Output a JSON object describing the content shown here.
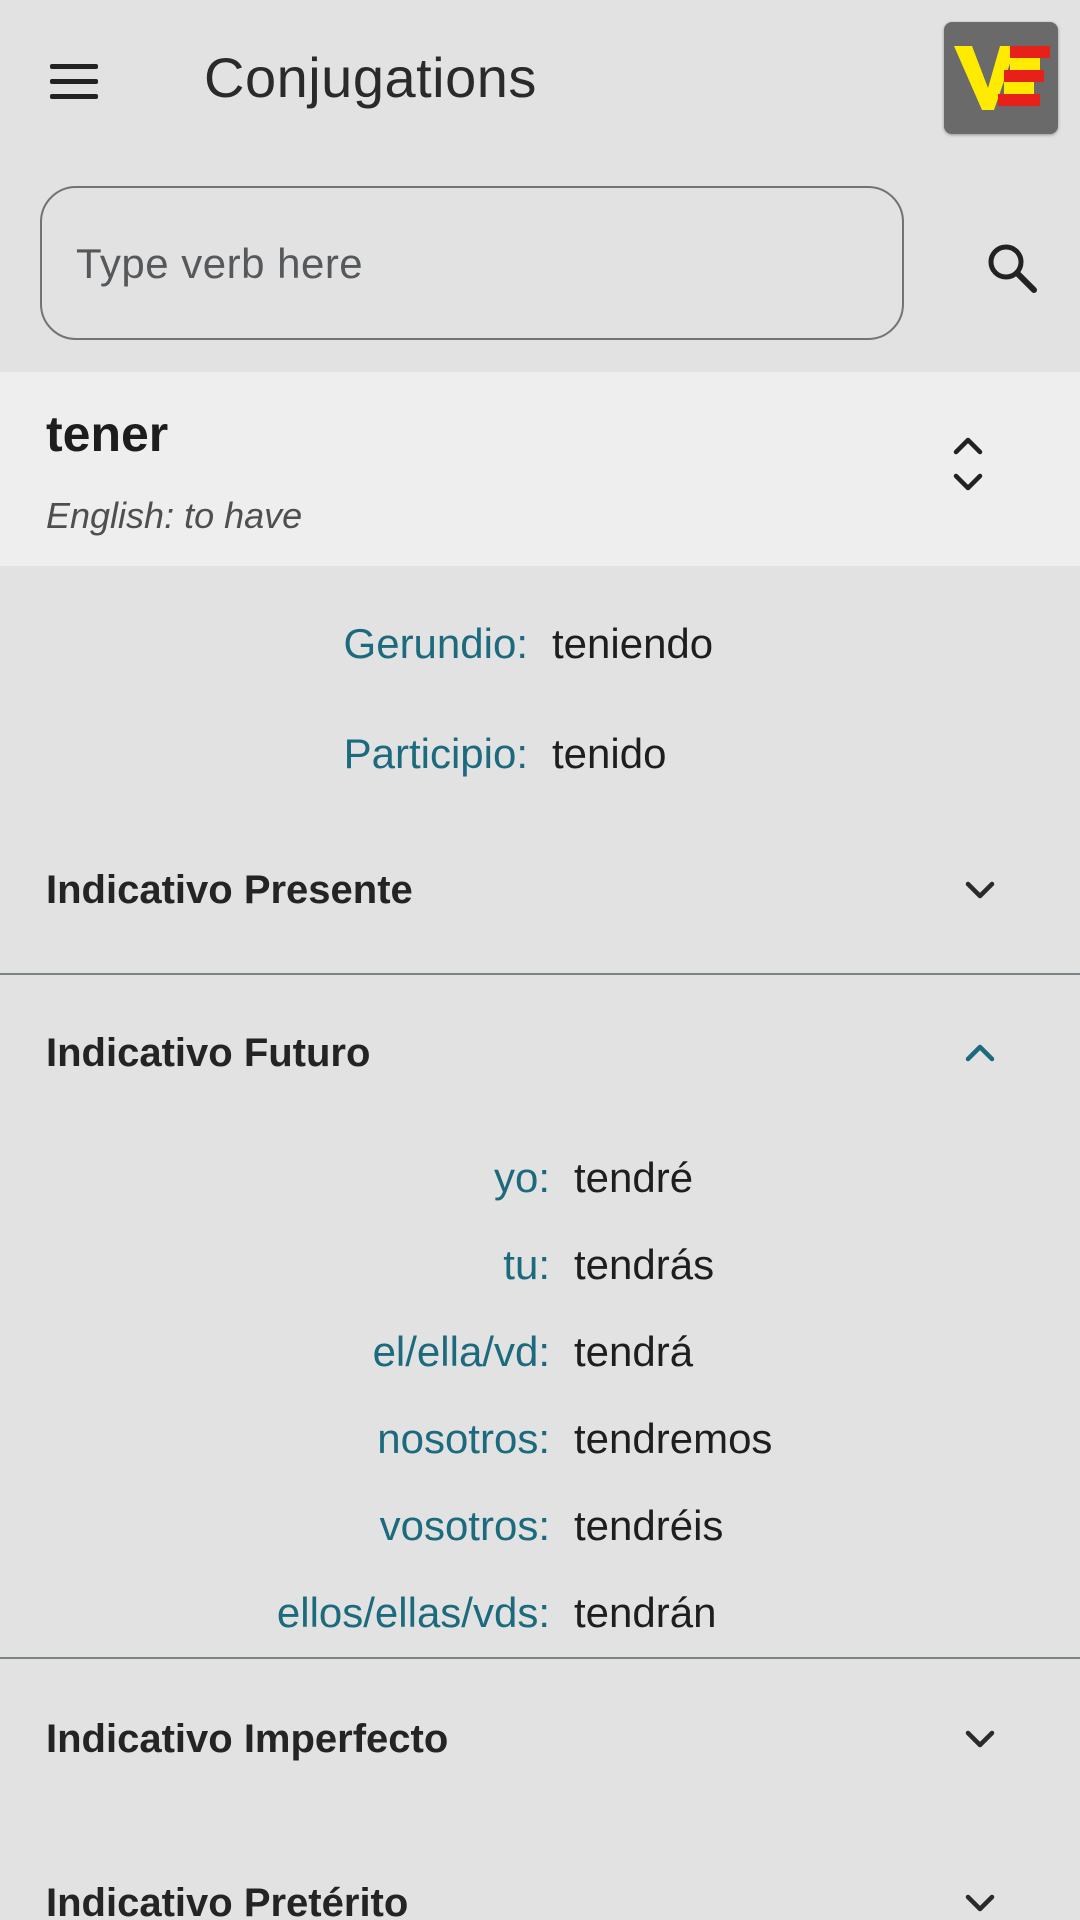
{
  "app_bar": {
    "title": "Conjugations",
    "menu_icon": "hamburger-menu-icon",
    "logo_text": "VE"
  },
  "search": {
    "placeholder": "Type verb here",
    "value": "",
    "icon": "search-icon"
  },
  "verb": {
    "infinitive": "tener",
    "translation": "English: to have",
    "sort_icon": "unfold-more-icon"
  },
  "forms": [
    {
      "label": "Gerundio:",
      "value": "teniendo"
    },
    {
      "label": "Participio:",
      "value": "tenido"
    }
  ],
  "sections": [
    {
      "title": "Indicativo Presente",
      "expanded": false
    },
    {
      "title": "Indicativo Futuro",
      "expanded": true
    },
    {
      "title": "Indicativo Imperfecto",
      "expanded": false
    },
    {
      "title": "Indicativo Pretérito",
      "expanded": false
    }
  ],
  "futuro": [
    {
      "pronoun": "yo:",
      "form": "tendré"
    },
    {
      "pronoun": "tu:",
      "form": "tendrás"
    },
    {
      "pronoun": "el/ella/vd:",
      "form": "tendrá"
    },
    {
      "pronoun": "nosotros:",
      "form": "tendremos"
    },
    {
      "pronoun": "vosotros:",
      "form": "tendréis"
    },
    {
      "pronoun": "ellos/ellas/vds:",
      "form": "tendrán"
    }
  ],
  "colors": {
    "background": "#e2e2e2",
    "header_background": "#eeeeee",
    "accent_teal": "#1b6a7d",
    "logo_yellow": "#ffeb00",
    "logo_red": "#e8201a",
    "logo_background": "#6a6a6a"
  }
}
